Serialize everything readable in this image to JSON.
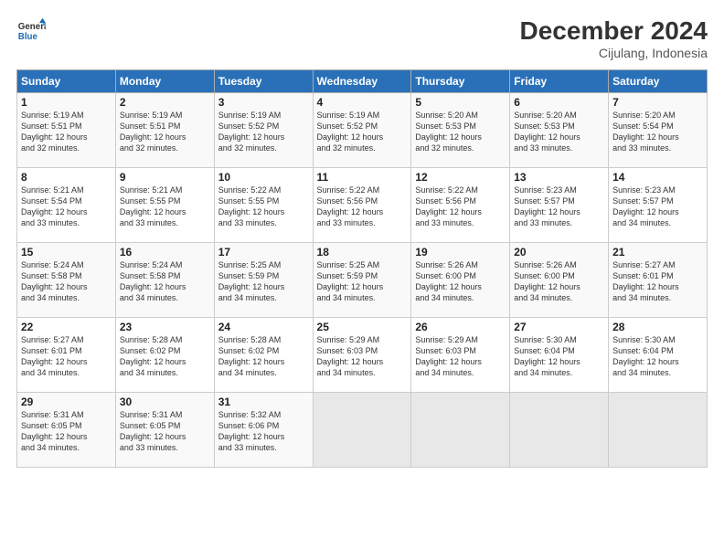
{
  "logo": {
    "line1": "General",
    "line2": "Blue"
  },
  "title": "December 2024",
  "subtitle": "Cijulang, Indonesia",
  "days_of_week": [
    "Sunday",
    "Monday",
    "Tuesday",
    "Wednesday",
    "Thursday",
    "Friday",
    "Saturday"
  ],
  "weeks": [
    [
      {
        "day": "1",
        "text": "Sunrise: 5:19 AM\nSunset: 5:51 PM\nDaylight: 12 hours\nand 32 minutes."
      },
      {
        "day": "2",
        "text": "Sunrise: 5:19 AM\nSunset: 5:51 PM\nDaylight: 12 hours\nand 32 minutes."
      },
      {
        "day": "3",
        "text": "Sunrise: 5:19 AM\nSunset: 5:52 PM\nDaylight: 12 hours\nand 32 minutes."
      },
      {
        "day": "4",
        "text": "Sunrise: 5:19 AM\nSunset: 5:52 PM\nDaylight: 12 hours\nand 32 minutes."
      },
      {
        "day": "5",
        "text": "Sunrise: 5:20 AM\nSunset: 5:53 PM\nDaylight: 12 hours\nand 32 minutes."
      },
      {
        "day": "6",
        "text": "Sunrise: 5:20 AM\nSunset: 5:53 PM\nDaylight: 12 hours\nand 33 minutes."
      },
      {
        "day": "7",
        "text": "Sunrise: 5:20 AM\nSunset: 5:54 PM\nDaylight: 12 hours\nand 33 minutes."
      }
    ],
    [
      {
        "day": "8",
        "text": "Sunrise: 5:21 AM\nSunset: 5:54 PM\nDaylight: 12 hours\nand 33 minutes."
      },
      {
        "day": "9",
        "text": "Sunrise: 5:21 AM\nSunset: 5:55 PM\nDaylight: 12 hours\nand 33 minutes."
      },
      {
        "day": "10",
        "text": "Sunrise: 5:22 AM\nSunset: 5:55 PM\nDaylight: 12 hours\nand 33 minutes."
      },
      {
        "day": "11",
        "text": "Sunrise: 5:22 AM\nSunset: 5:56 PM\nDaylight: 12 hours\nand 33 minutes."
      },
      {
        "day": "12",
        "text": "Sunrise: 5:22 AM\nSunset: 5:56 PM\nDaylight: 12 hours\nand 33 minutes."
      },
      {
        "day": "13",
        "text": "Sunrise: 5:23 AM\nSunset: 5:57 PM\nDaylight: 12 hours\nand 33 minutes."
      },
      {
        "day": "14",
        "text": "Sunrise: 5:23 AM\nSunset: 5:57 PM\nDaylight: 12 hours\nand 34 minutes."
      }
    ],
    [
      {
        "day": "15",
        "text": "Sunrise: 5:24 AM\nSunset: 5:58 PM\nDaylight: 12 hours\nand 34 minutes."
      },
      {
        "day": "16",
        "text": "Sunrise: 5:24 AM\nSunset: 5:58 PM\nDaylight: 12 hours\nand 34 minutes."
      },
      {
        "day": "17",
        "text": "Sunrise: 5:25 AM\nSunset: 5:59 PM\nDaylight: 12 hours\nand 34 minutes."
      },
      {
        "day": "18",
        "text": "Sunrise: 5:25 AM\nSunset: 5:59 PM\nDaylight: 12 hours\nand 34 minutes."
      },
      {
        "day": "19",
        "text": "Sunrise: 5:26 AM\nSunset: 6:00 PM\nDaylight: 12 hours\nand 34 minutes."
      },
      {
        "day": "20",
        "text": "Sunrise: 5:26 AM\nSunset: 6:00 PM\nDaylight: 12 hours\nand 34 minutes."
      },
      {
        "day": "21",
        "text": "Sunrise: 5:27 AM\nSunset: 6:01 PM\nDaylight: 12 hours\nand 34 minutes."
      }
    ],
    [
      {
        "day": "22",
        "text": "Sunrise: 5:27 AM\nSunset: 6:01 PM\nDaylight: 12 hours\nand 34 minutes."
      },
      {
        "day": "23",
        "text": "Sunrise: 5:28 AM\nSunset: 6:02 PM\nDaylight: 12 hours\nand 34 minutes."
      },
      {
        "day": "24",
        "text": "Sunrise: 5:28 AM\nSunset: 6:02 PM\nDaylight: 12 hours\nand 34 minutes."
      },
      {
        "day": "25",
        "text": "Sunrise: 5:29 AM\nSunset: 6:03 PM\nDaylight: 12 hours\nand 34 minutes."
      },
      {
        "day": "26",
        "text": "Sunrise: 5:29 AM\nSunset: 6:03 PM\nDaylight: 12 hours\nand 34 minutes."
      },
      {
        "day": "27",
        "text": "Sunrise: 5:30 AM\nSunset: 6:04 PM\nDaylight: 12 hours\nand 34 minutes."
      },
      {
        "day": "28",
        "text": "Sunrise: 5:30 AM\nSunset: 6:04 PM\nDaylight: 12 hours\nand 34 minutes."
      }
    ],
    [
      {
        "day": "29",
        "text": "Sunrise: 5:31 AM\nSunset: 6:05 PM\nDaylight: 12 hours\nand 34 minutes."
      },
      {
        "day": "30",
        "text": "Sunrise: 5:31 AM\nSunset: 6:05 PM\nDaylight: 12 hours\nand 33 minutes."
      },
      {
        "day": "31",
        "text": "Sunrise: 5:32 AM\nSunset: 6:06 PM\nDaylight: 12 hours\nand 33 minutes."
      },
      {
        "day": "",
        "text": ""
      },
      {
        "day": "",
        "text": ""
      },
      {
        "day": "",
        "text": ""
      },
      {
        "day": "",
        "text": ""
      }
    ]
  ]
}
